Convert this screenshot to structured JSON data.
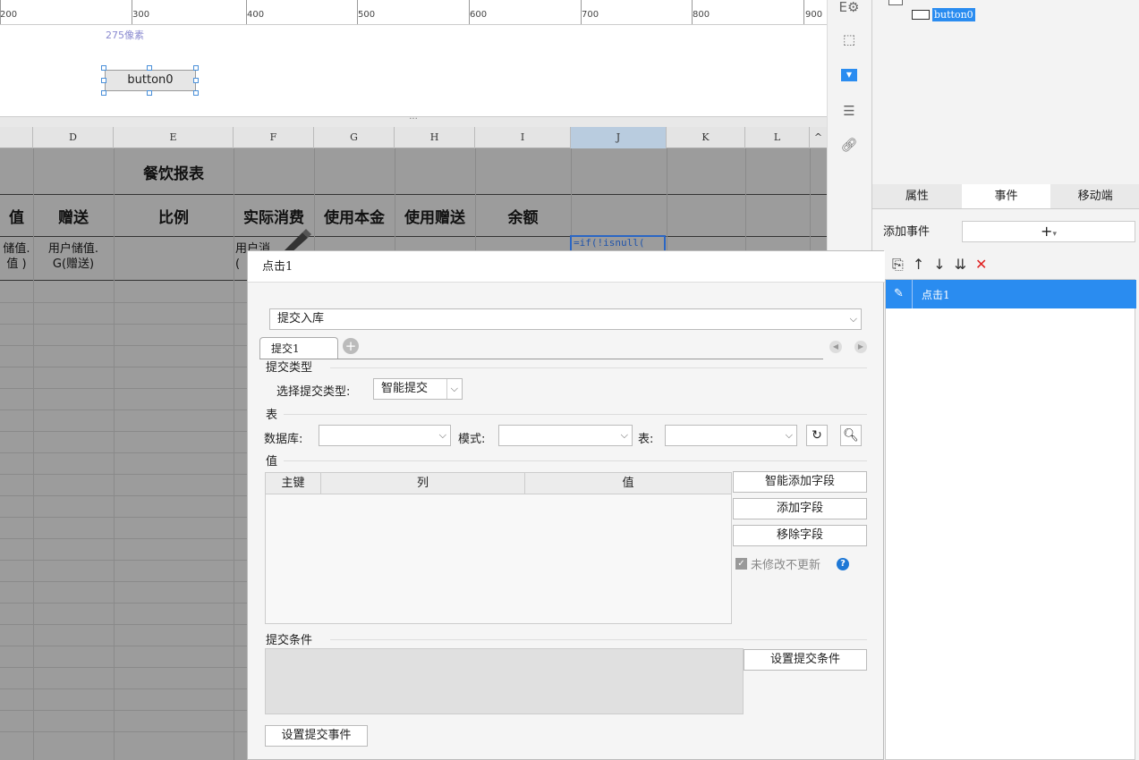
{
  "ruler": {
    "labels": [
      "200",
      "300",
      "400",
      "500",
      "600",
      "700",
      "800",
      "900"
    ]
  },
  "design": {
    "dimension_hint": "275像素",
    "button_label": "button0"
  },
  "sheet": {
    "columns": [
      "D",
      "E",
      "F",
      "G",
      "H",
      "I",
      "J",
      "K",
      "L"
    ],
    "title": "餐饮报表",
    "headers": {
      "c": "值",
      "d": "赠送",
      "e": "比例",
      "f": "实际消费",
      "g": "使用本金",
      "h": "使用赠送",
      "i": "余额"
    },
    "row3": {
      "c": "储值.\n值 )",
      "d": "用户储值.\nG(赠送)",
      "f": "用户消\n(",
      "j": "=if(!isnull("
    }
  },
  "tree": {
    "node_label": "button0"
  },
  "panel": {
    "tabs": [
      "属性",
      "事件",
      "移动端"
    ],
    "add_event_label": "添加事件",
    "add_button": "+",
    "event_item": "点击1"
  },
  "dialog": {
    "title": "点击1",
    "action_select": "提交入库",
    "sub_tab": "提交1",
    "section_submit_type": "提交类型",
    "choose_type_label": "选择提交类型:",
    "type_value": "智能提交",
    "section_table": "表",
    "db_label": "数据库:",
    "mode_label": "模式:",
    "table_label": "表:",
    "section_value": "值",
    "value_columns": [
      "主键",
      "列",
      "值"
    ],
    "smart_add_field": "智能添加字段",
    "add_field": "添加字段",
    "remove_field": "移除字段",
    "no_update_unmodified": "未修改不更新",
    "section_condition": "提交条件",
    "set_condition": "设置提交条件",
    "set_event": "设置提交事件"
  }
}
